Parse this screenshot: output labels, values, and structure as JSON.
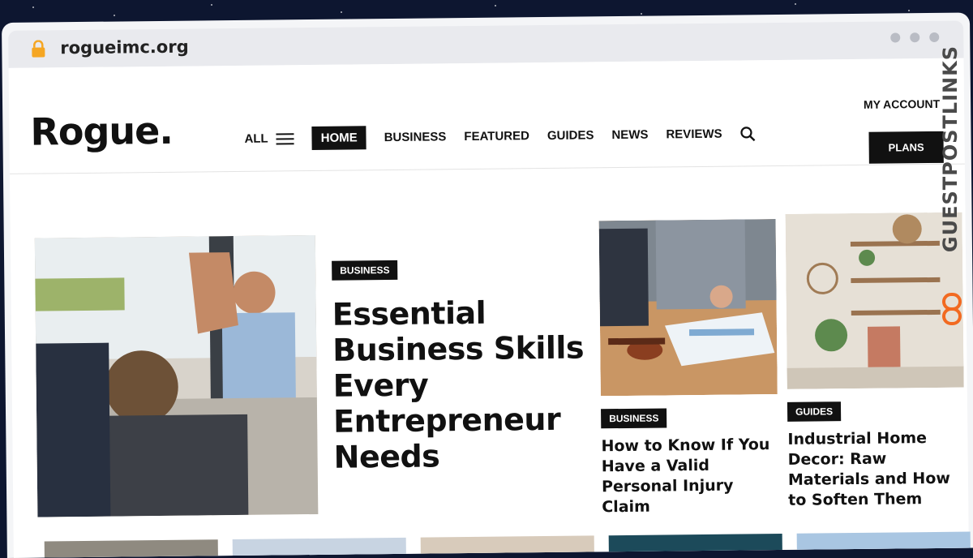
{
  "browser": {
    "url": "rogueimc.org"
  },
  "site": {
    "logo": "Rogue.",
    "nav": {
      "all_label": "ALL",
      "items": [
        "HOME",
        "BUSINESS",
        "FEATURED",
        "GUIDES",
        "NEWS",
        "REVIEWS"
      ],
      "active": "HOME"
    },
    "my_account": "MY ACCOUNT",
    "plans": "PLANS"
  },
  "hero": {
    "tag": "BUSINESS",
    "title": "Essential Business Skills Every Entrepreneur Needs"
  },
  "cards": [
    {
      "tag": "BUSINESS",
      "title": "How to Know If You Have a Valid Personal Injury Claim"
    },
    {
      "tag": "GUIDES",
      "title": "Industrial Home Decor: Raw Materials and How to Soften Them"
    }
  ],
  "watermark": {
    "text": "GUESTPOSTLINKS"
  },
  "colors": {
    "accent": "#111111",
    "watermark_orange": "#f26a21",
    "background": "#0d1630"
  },
  "icons": {
    "lock": "lock-icon",
    "menu": "hamburger-icon",
    "search": "search-icon"
  }
}
